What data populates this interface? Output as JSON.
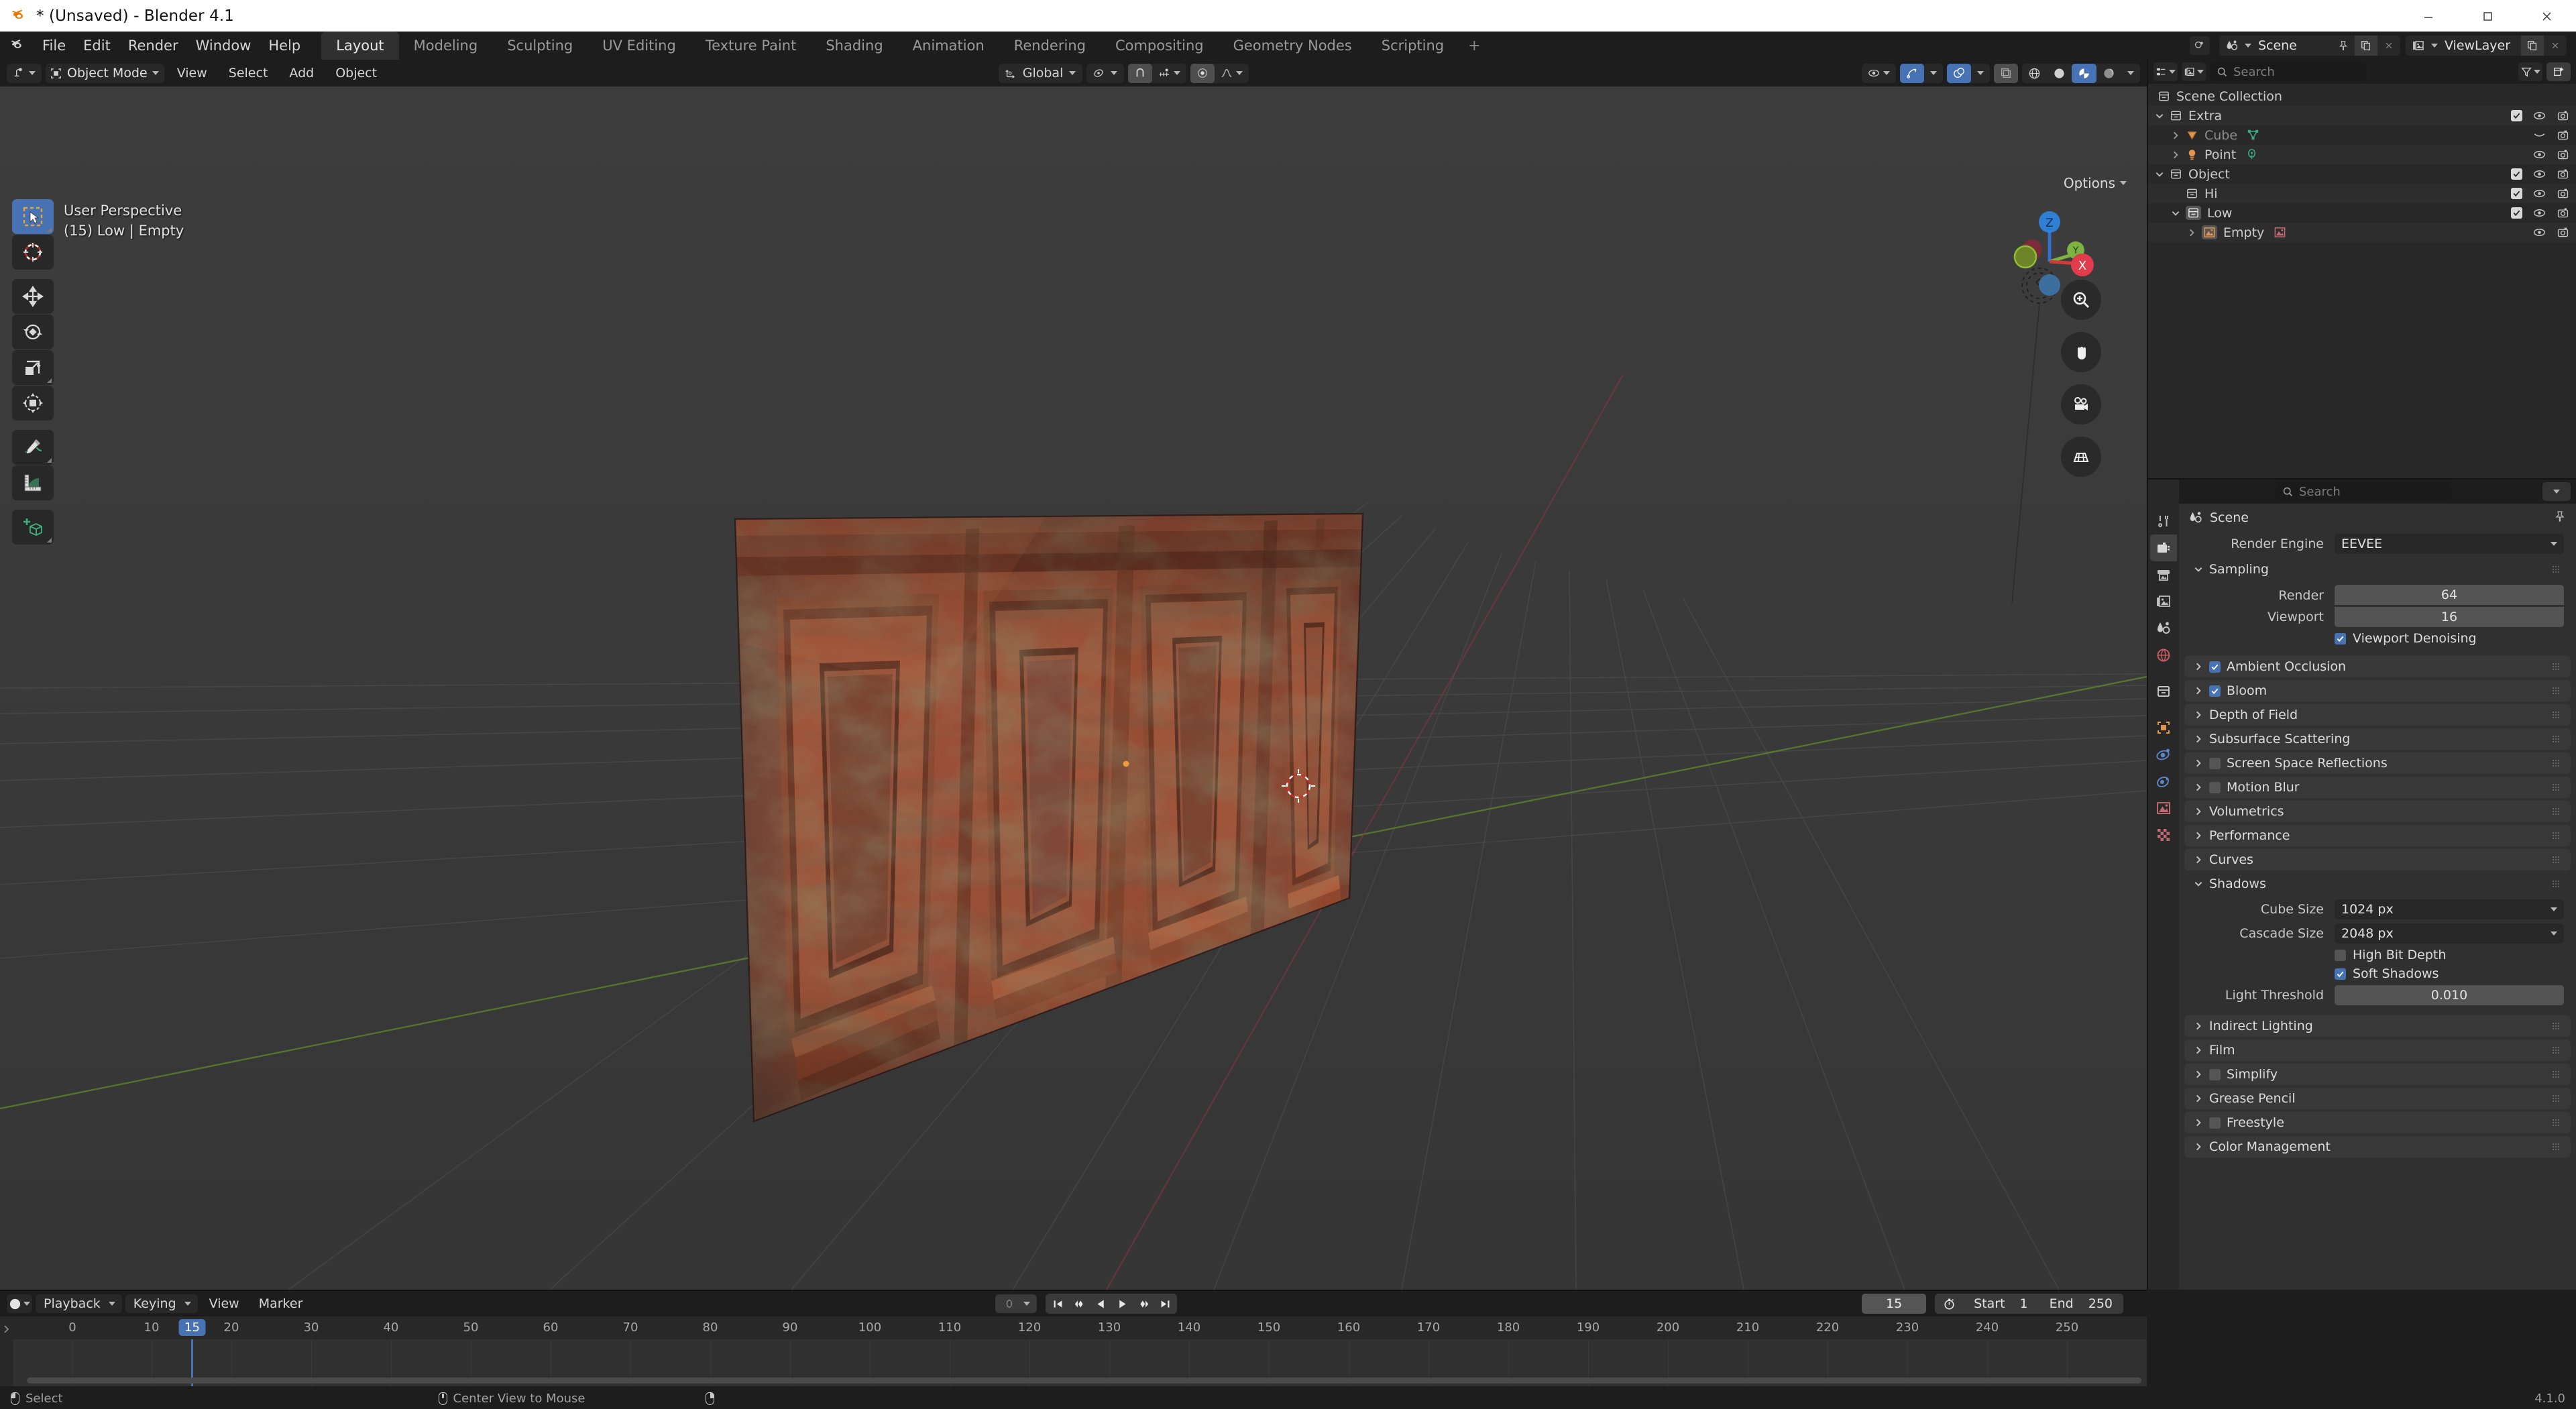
{
  "window": {
    "title": "* (Unsaved) - Blender 4.1",
    "app_icon": "blender-logo-icon",
    "controls": {
      "minimize": "minimize-icon",
      "maximize": "maximize-icon",
      "close": "close-icon"
    }
  },
  "topbar": {
    "menus": [
      "File",
      "Edit",
      "Render",
      "Window",
      "Help"
    ],
    "workspace_tabs": [
      {
        "label": "Layout",
        "active": true
      },
      {
        "label": "Modeling",
        "active": false
      },
      {
        "label": "Sculpting",
        "active": false
      },
      {
        "label": "UV Editing",
        "active": false
      },
      {
        "label": "Texture Paint",
        "active": false
      },
      {
        "label": "Shading",
        "active": false
      },
      {
        "label": "Animation",
        "active": false
      },
      {
        "label": "Rendering",
        "active": false
      },
      {
        "label": "Compositing",
        "active": false
      },
      {
        "label": "Geometry Nodes",
        "active": false
      },
      {
        "label": "Scripting",
        "active": false
      }
    ],
    "add_workspace": "+",
    "scene": {
      "label": "Scene",
      "icon": "scene-icon",
      "new_icon": "duplicate-icon",
      "unlink_icon": "close-icon",
      "pin_icon": "pin-icon"
    },
    "viewlayer": {
      "label": "ViewLayer",
      "icon": "viewlayer-icon",
      "new_icon": "duplicate-icon",
      "unlink_icon": "close-icon"
    }
  },
  "viewport": {
    "header": {
      "editor_type_icon": "editor-type-3dview-icon",
      "mode": "Object Mode",
      "mode_icon": "object-mode-icon",
      "menus": [
        "View",
        "Select",
        "Add",
        "Object"
      ],
      "transform_orientation": "Global",
      "transform_orientation_icon": "orientation-icon",
      "pivot_icon": "pivot-point-icon",
      "snap_icon": "magnet-icon",
      "snap_target_icon": "snap-increment-icon",
      "proportional_icon": "proportional-edit-icon",
      "falloff_icon": "smooth-falloff-icon",
      "visibility_icon": "object-types-visibility-icon",
      "gizmo_icon": "gizmo-icon",
      "overlays_icon": "overlays-icon",
      "xray_icon": "xray-icon",
      "shading_modes": [
        "wireframe",
        "solid",
        "material-preview",
        "rendered"
      ],
      "shading_active": "material-preview"
    },
    "overlay_text_line1": "User Perspective",
    "overlay_text_line2": "(15) Low | Empty",
    "options_label": "Options",
    "gizmo_axes": [
      "Z",
      "Y",
      "X"
    ],
    "nav_buttons": [
      "zoom-icon",
      "hand-move-icon",
      "camera-view-icon",
      "orthographic-toggle-icon"
    ],
    "toolbar": [
      {
        "name": "tweak-select-tool",
        "active": true
      },
      {
        "name": "cursor-tool",
        "active": false
      },
      {
        "name": "move-tool",
        "active": false
      },
      {
        "name": "rotate-tool",
        "active": false
      },
      {
        "name": "scale-tool",
        "active": false
      },
      {
        "name": "transform-tool",
        "active": false
      },
      {
        "name": "annotate-tool",
        "active": false
      },
      {
        "name": "measure-tool",
        "active": false
      },
      {
        "name": "add-cube-tool",
        "active": false
      }
    ],
    "select_modes": [
      "set-new-selection",
      "extend-selection",
      "subtract-selection",
      "invert-selection",
      "intersect-selection"
    ]
  },
  "outliner": {
    "display_mode_icon": "outliner-display-mode-icon",
    "view_layer_icon": "viewlayer-icon",
    "search_placeholder": "Search",
    "filter_icon": "filter-funnel-icon",
    "new_collection_icon": "new-collection-icon",
    "tree": [
      {
        "label": "Scene Collection",
        "depth": 0,
        "icon": "collection-icon",
        "expander": "none",
        "checkbox": false,
        "eye": false,
        "camera": false,
        "selected": false,
        "dim": false
      },
      {
        "label": "Extra",
        "depth": 1,
        "icon": "collection-icon",
        "expander": "down",
        "checkbox": true,
        "eye": true,
        "camera": true,
        "selected": false,
        "dim": false
      },
      {
        "label": "Cube",
        "depth": 2,
        "icon": "mesh-object-icon",
        "data_icon": "mesh-data-icon",
        "expander": "right",
        "checkbox": false,
        "eye": "closed",
        "camera": true,
        "selected": false,
        "dim": true
      },
      {
        "label": "Point",
        "depth": 2,
        "icon": "light-object-icon",
        "data_icon": "point-light-data-icon",
        "expander": "right",
        "checkbox": false,
        "eye": true,
        "camera": true,
        "selected": false,
        "dim": false
      },
      {
        "label": "Object",
        "depth": 1,
        "icon": "collection-icon",
        "expander": "down",
        "checkbox": true,
        "eye": true,
        "camera": true,
        "selected": false,
        "dim": false
      },
      {
        "label": "Hi",
        "depth": 2,
        "icon": "collection-icon",
        "expander": "none",
        "checkbox": true,
        "eye": true,
        "camera": true,
        "selected": false,
        "dim": false
      },
      {
        "label": "Low",
        "depth": 2,
        "icon": "collection-icon",
        "expander": "down",
        "checkbox": true,
        "eye": true,
        "camera": true,
        "selected": true,
        "dim": false
      },
      {
        "label": "Empty",
        "depth": 3,
        "icon": "image-empty-object-icon",
        "data_icon": "image-data-icon",
        "expander": "right",
        "checkbox": false,
        "eye": true,
        "camera": true,
        "selected": false,
        "dim": false
      }
    ]
  },
  "properties": {
    "search_placeholder": "Search",
    "breadcrumb": "Scene",
    "breadcrumb_icon": "scene-icon",
    "pin_icon": "pin-icon",
    "tabs": [
      {
        "name": "tool-tab",
        "icon": "tool-icon",
        "active": false
      },
      {
        "name": "render-tab",
        "icon": "render-camera-icon",
        "active": true
      },
      {
        "name": "output-tab",
        "icon": "printer-output-icon",
        "active": false
      },
      {
        "name": "viewlayer-tab",
        "icon": "viewlayer-images-icon",
        "active": false
      },
      {
        "name": "scene-tab",
        "icon": "scene-cone-icon",
        "active": false
      },
      {
        "name": "world-tab",
        "icon": "world-globe-icon",
        "active": false
      },
      {
        "name": "collection-tab",
        "icon": "collection-box-icon",
        "active": false
      },
      {
        "name": "object-tab",
        "icon": "object-square-icon",
        "active": false
      },
      {
        "name": "modifiers-tab",
        "icon": "physics-orbit-icon",
        "active": false
      },
      {
        "name": "constraints-tab",
        "icon": "constraint-icon",
        "active": false
      },
      {
        "name": "object-data-tab",
        "icon": "image-data-icon",
        "active": false
      },
      {
        "name": "texture-tab",
        "icon": "checker-texture-icon",
        "active": false
      }
    ],
    "render_engine_label": "Render Engine",
    "render_engine_value": "EEVEE",
    "panels": [
      {
        "label": "Sampling",
        "open": true,
        "checkbox": null,
        "fields": [
          {
            "label": "Render",
            "value": "64",
            "type": "number"
          },
          {
            "label": "Viewport",
            "value": "16",
            "type": "number"
          }
        ],
        "checks": [
          {
            "label": "Viewport Denoising",
            "checked": true
          }
        ]
      },
      {
        "label": "Ambient Occlusion",
        "open": false,
        "checkbox": true
      },
      {
        "label": "Bloom",
        "open": false,
        "checkbox": true
      },
      {
        "label": "Depth of Field",
        "open": false,
        "checkbox": null
      },
      {
        "label": "Subsurface Scattering",
        "open": false,
        "checkbox": null
      },
      {
        "label": "Screen Space Reflections",
        "open": false,
        "checkbox": false
      },
      {
        "label": "Motion Blur",
        "open": false,
        "checkbox": false
      },
      {
        "label": "Volumetrics",
        "open": false,
        "checkbox": null
      },
      {
        "label": "Performance",
        "open": false,
        "checkbox": null
      },
      {
        "label": "Curves",
        "open": false,
        "checkbox": null
      },
      {
        "label": "Shadows",
        "open": true,
        "checkbox": null,
        "fields": [
          {
            "label": "Cube Size",
            "value": "1024 px",
            "type": "dropdown"
          },
          {
            "label": "Cascade Size",
            "value": "2048 px",
            "type": "dropdown"
          }
        ],
        "checks": [
          {
            "label": "High Bit Depth",
            "checked": false
          },
          {
            "label": "Soft Shadows",
            "checked": true
          }
        ],
        "fields2": [
          {
            "label": "Light Threshold",
            "value": "0.010",
            "type": "number"
          }
        ]
      },
      {
        "label": "Indirect Lighting",
        "open": false,
        "checkbox": null
      },
      {
        "label": "Film",
        "open": false,
        "checkbox": null
      },
      {
        "label": "Simplify",
        "open": false,
        "checkbox": false
      },
      {
        "label": "Grease Pencil",
        "open": false,
        "checkbox": null
      },
      {
        "label": "Freestyle",
        "open": false,
        "checkbox": false
      },
      {
        "label": "Color Management",
        "open": false,
        "checkbox": null
      }
    ]
  },
  "timeline": {
    "editor_icon": "timeline-editor-icon",
    "menus": [
      "Playback",
      "Keying",
      "View",
      "Marker"
    ],
    "keying_set_value": "",
    "playback_buttons": [
      "jump-to-start-icon",
      "jump-to-prev-keyframe-icon",
      "play-reverse-icon",
      "play-icon",
      "jump-to-next-keyframe-icon",
      "jump-to-end-icon"
    ],
    "current_frame": "15",
    "autokey_icon": "stopwatch-autokey-icon",
    "start_label": "Start",
    "start_value": "1",
    "end_label": "End",
    "end_value": "250",
    "ruler_ticks": [
      "0",
      "10",
      "20",
      "30",
      "40",
      "50",
      "60",
      "70",
      "80",
      "90",
      "100",
      "110",
      "120",
      "130",
      "140",
      "150",
      "160",
      "170",
      "180",
      "190",
      "200",
      "210",
      "220",
      "230",
      "240",
      "250"
    ],
    "playhead_frame": "15"
  },
  "statusbar": {
    "items": [
      {
        "icon": "mouse-left-icon",
        "label": "Select"
      },
      {
        "icon": "mouse-middle-icon",
        "label": "Center View to Mouse"
      },
      {
        "icon": "mouse-right-icon",
        "label": ""
      }
    ],
    "version": "4.1.0"
  },
  "colors": {
    "accent_blue": "#4772b3",
    "editor_bg": "#303030",
    "header_bg": "#1d1d1d",
    "viewport_bg": "#393939",
    "text": "#d8d8d8"
  }
}
